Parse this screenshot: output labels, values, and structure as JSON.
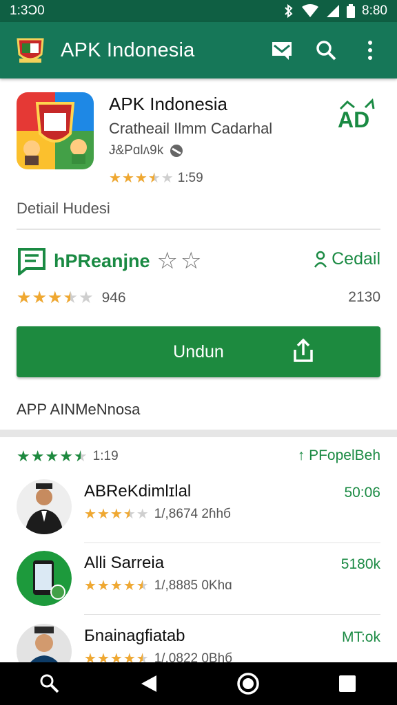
{
  "status": {
    "left_time": "1:3Ɔ0",
    "right_time": "8:80",
    "icons": [
      "bluetooth-icon",
      "wifi-icon",
      "signal-icon",
      "battery-icon"
    ]
  },
  "appbar": {
    "title": "APK Indonesia",
    "icons": [
      "inbox-icon",
      "search-icon",
      "more-vert-icon"
    ]
  },
  "app": {
    "name": "APK Indonesia",
    "developer": "Cratheail Ilmm Cadarhal",
    "meta": "Ɉ&Pɑlʌ9k",
    "rating_text": "1:59",
    "rating_value": 3.5,
    "badge": "AD"
  },
  "detail_label": "Detiail Hudesi",
  "feature": {
    "title": "hPReanjne",
    "detail_link": "Cedail",
    "rating_count": "946",
    "right_count": "2130",
    "rating_value": 3.5
  },
  "download": {
    "label": "Undun"
  },
  "about": "APP AINMeNnosa",
  "reviews": {
    "count": "1:19",
    "link": "PFopelBeh",
    "rating_value": 4.5
  },
  "items": [
    {
      "name": "ABReKdimlɪlal",
      "sub": "1/,8674 2ɦhб",
      "value": "50:06",
      "rating": 3.5
    },
    {
      "name": "Alli Sarreia",
      "sub": "1/,8885 0Khɑ",
      "value": "5180k",
      "rating": 4.5
    },
    {
      "name": "Бnainagfiatab",
      "sub": "1/,0822 0Bhб",
      "value": "MT:ok",
      "rating": 4.5
    }
  ],
  "colors": {
    "primary_dark": "#0f5f43",
    "primary": "#167758",
    "accent": "#1d8a3f",
    "star": "#f0a830",
    "green_text": "#1a8a43"
  }
}
